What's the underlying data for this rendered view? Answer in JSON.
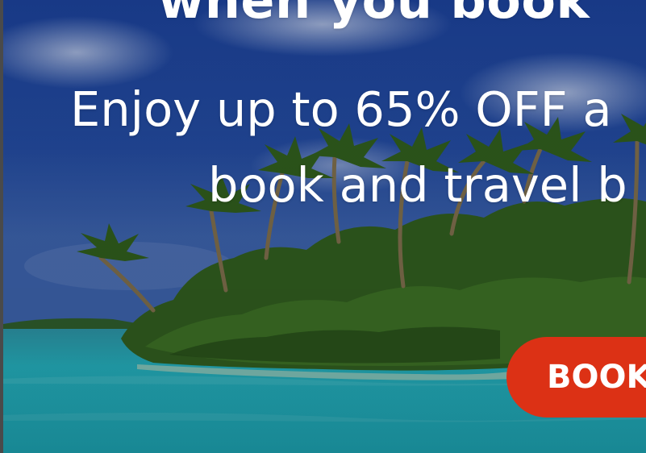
{
  "hero": {
    "headline": "when you book",
    "subtitle_line1": "Enjoy up to 65% OFF a",
    "subtitle_line2": "book and travel b",
    "cta_label": "BOOK"
  },
  "colors": {
    "sky": "#1b3f8f",
    "lagoon": "#1fa6b2",
    "foliage": "#2f5a1e",
    "cta_background": "#dc3115",
    "text": "#ffffff"
  }
}
